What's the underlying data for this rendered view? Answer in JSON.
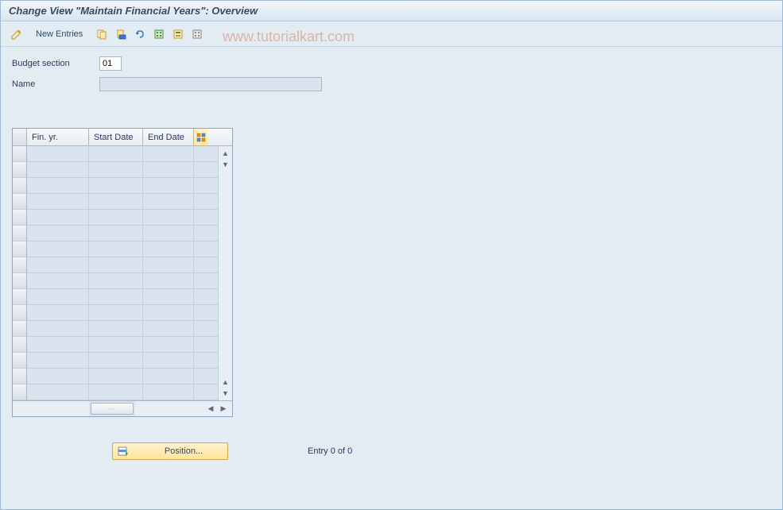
{
  "header": {
    "title": "Change View \"Maintain Financial Years\": Overview"
  },
  "toolbar": {
    "new_entries_label": "New Entries"
  },
  "form": {
    "budget_section_label": "Budget section",
    "budget_section_value": "01",
    "name_label": "Name",
    "name_value": ""
  },
  "table": {
    "columns": {
      "fin_yr": "Fin. yr.",
      "start_date": "Start Date",
      "end_date": "End Date"
    },
    "row_count": 16
  },
  "footer": {
    "position_label": "Position...",
    "entry_status": "Entry 0 of 0"
  },
  "watermark": "www.tutorialkart.com"
}
